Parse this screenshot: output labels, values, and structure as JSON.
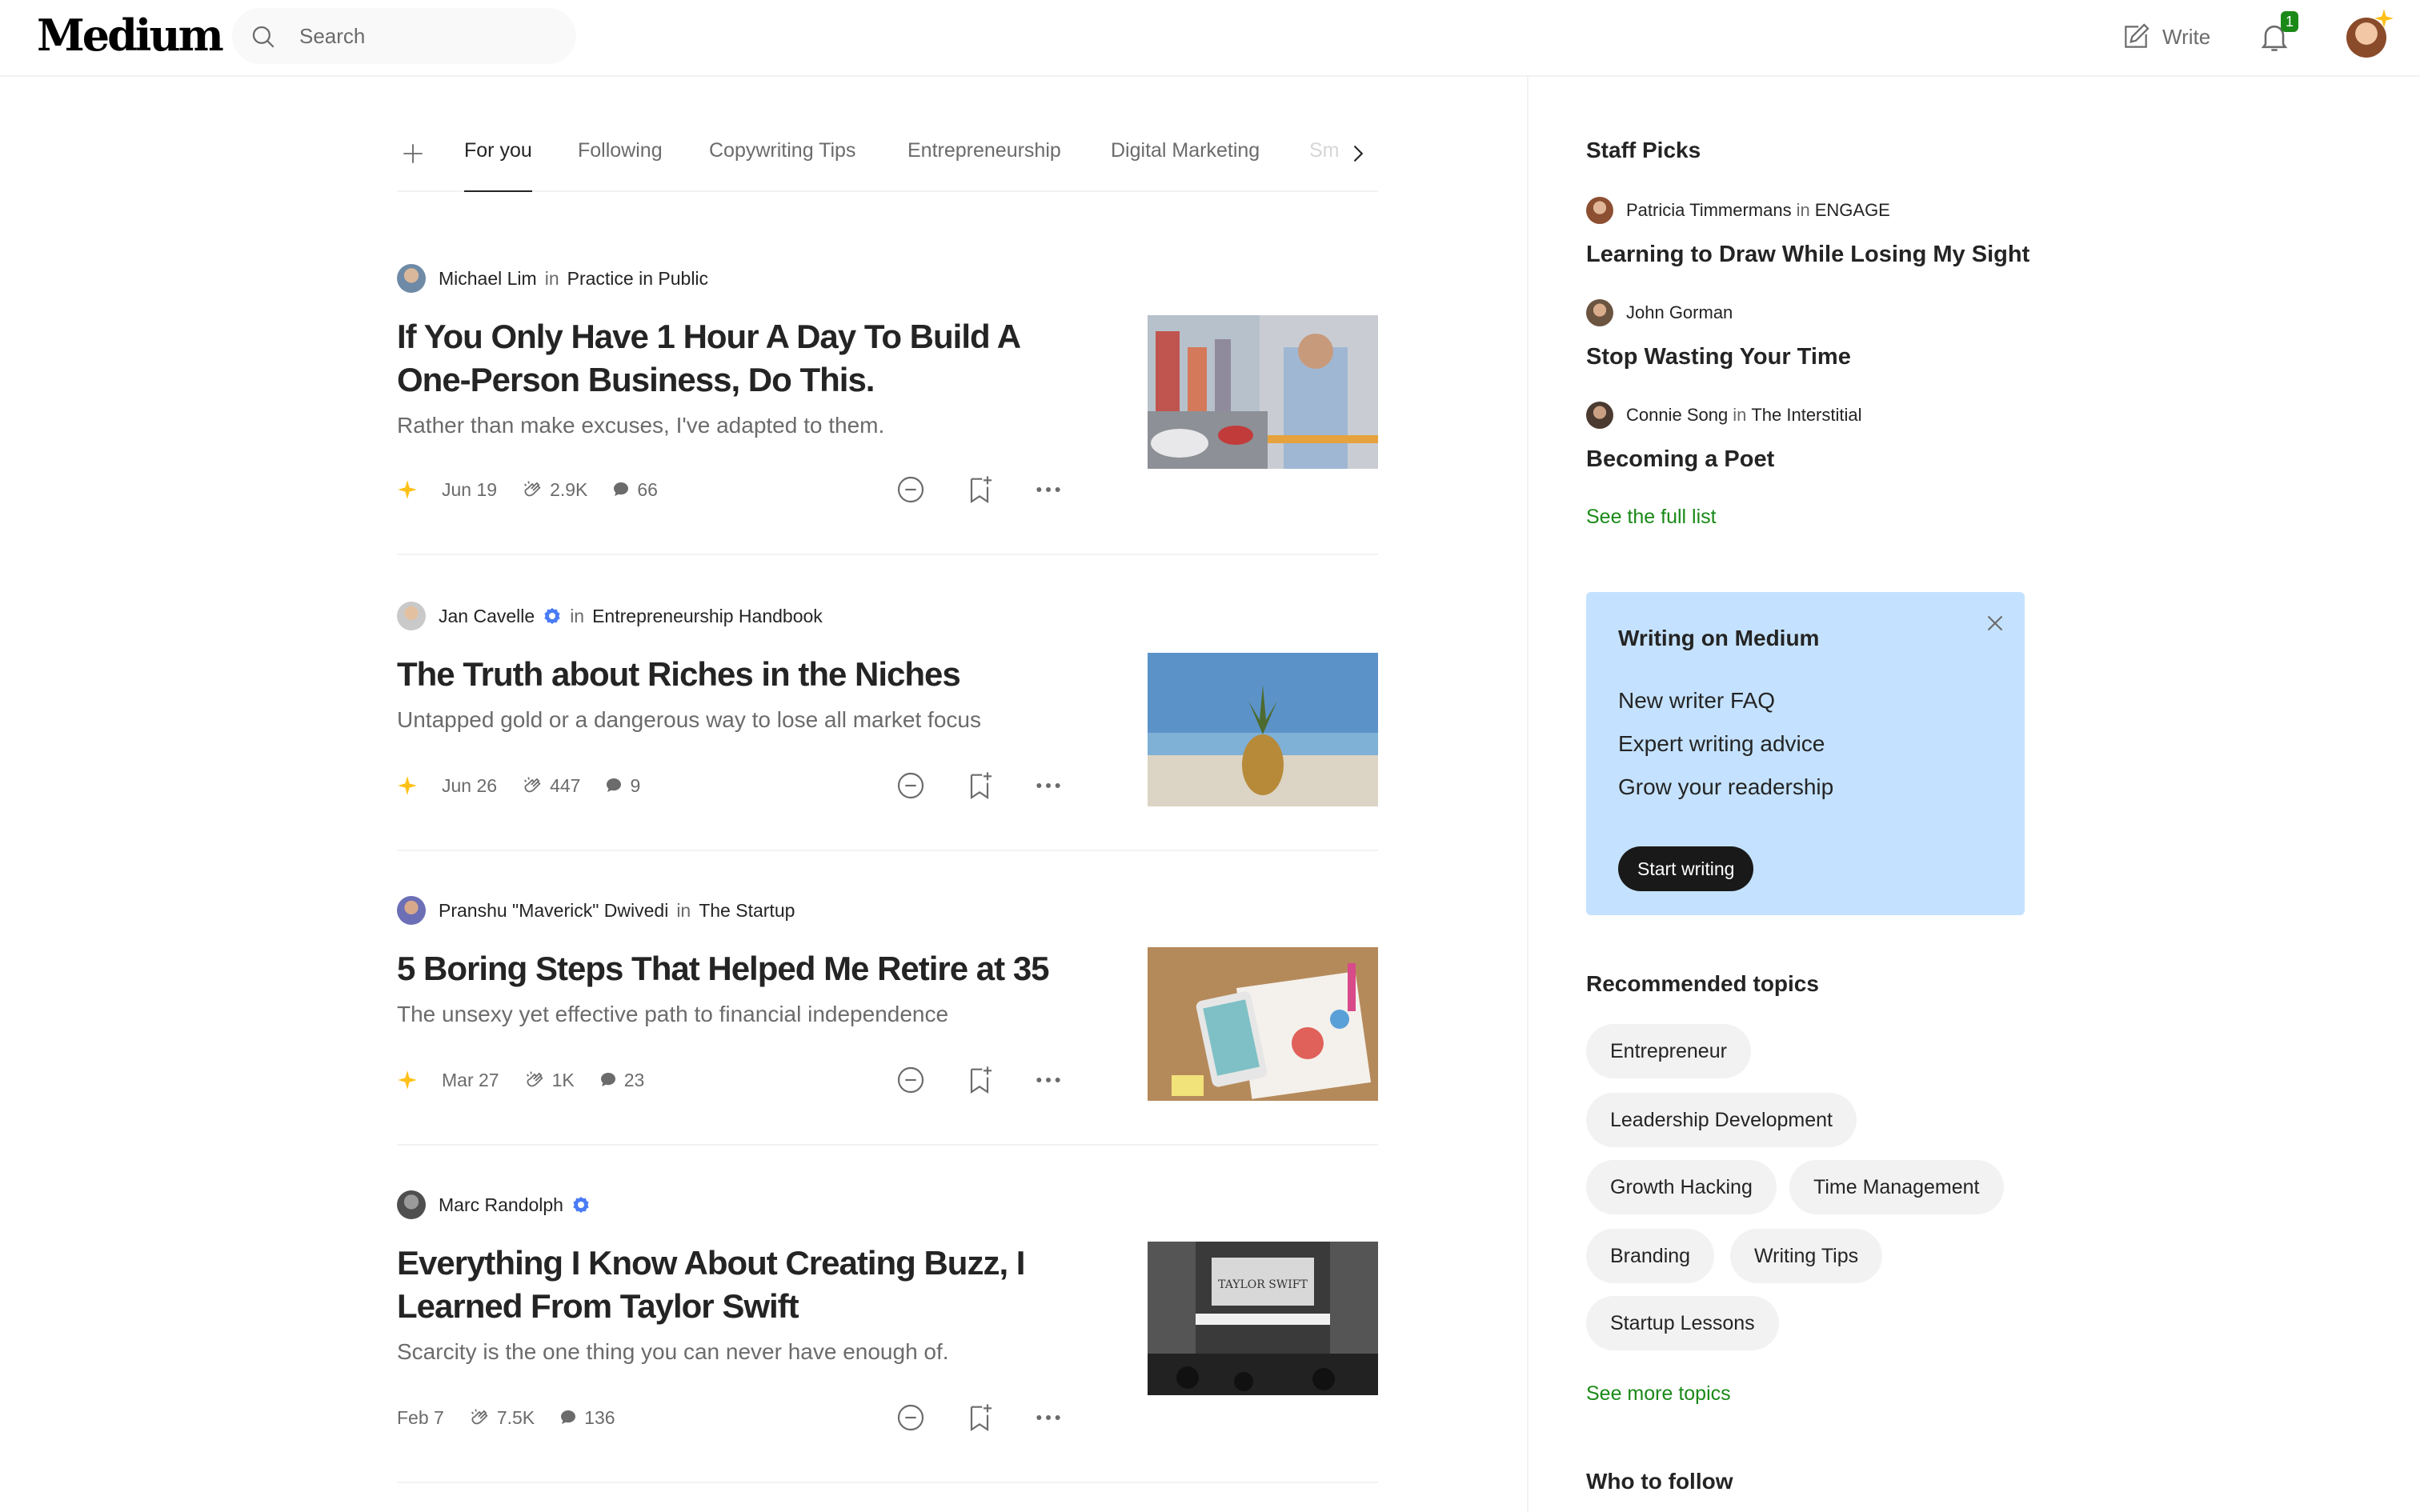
{
  "header": {
    "logo": "Medium",
    "search_placeholder": "Search",
    "write_label": "Write",
    "notification_count": "1"
  },
  "tabs": [
    {
      "label": "For you",
      "active": true
    },
    {
      "label": "Following"
    },
    {
      "label": "Copywriting Tips"
    },
    {
      "label": "Entrepreneurship"
    },
    {
      "label": "Digital Marketing"
    },
    {
      "label": "Sm"
    }
  ],
  "articles": [
    {
      "author": "Michael Lim",
      "in": "in",
      "publication": "Practice in Public",
      "title": "If You Only Have 1 Hour A Day To Build A One-Person Business, Do This.",
      "subtitle": "Rather than make excuses, I've adapted to them.",
      "date": "Jun 19",
      "claps": "2.9K",
      "comments": "66",
      "member_only": true,
      "thumb": "street-portrait"
    },
    {
      "author": "Jan Cavelle",
      "in": "in",
      "publication": "Entrepreneurship Handbook",
      "verified": true,
      "title": "The Truth about Riches in the Niches",
      "subtitle": "Untapped gold or a dangerous way to lose all market focus",
      "date": "Jun 26",
      "claps": "447",
      "comments": "9",
      "member_only": true,
      "thumb": "pineapple-beach"
    },
    {
      "author": "Pranshu \"Maverick\" Dwivedi",
      "in": "in",
      "publication": "The Startup",
      "title": "5 Boring Steps That Helped Me Retire at 35",
      "subtitle": "The unsexy yet effective path to financial independence",
      "date": "Mar 27",
      "claps": "1K",
      "comments": "23",
      "member_only": true,
      "thumb": "desk-charts"
    },
    {
      "author": "Marc Randolph",
      "verified": true,
      "title": "Everything I Know About Creating Buzz, I Learned From Taylor Swift",
      "subtitle": "Scarcity is the one thing you can never have enough of.",
      "date": "Feb 7",
      "claps": "7.5K",
      "comments": "136",
      "member_only": false,
      "thumb": "theater-marquee",
      "thumb_text": "TAYLOR SWIFT"
    }
  ],
  "sidebar": {
    "staff_picks_heading": "Staff Picks",
    "picks": [
      {
        "author": "Patricia Timmermans",
        "in": "in",
        "publication": "ENGAGE",
        "title": "Learning to Draw While Losing My Sight"
      },
      {
        "author": "John Gorman",
        "title": "Stop Wasting Your Time"
      },
      {
        "author": "Connie Song",
        "in": "in",
        "publication": "The Interstitial",
        "title": "Becoming a Poet"
      }
    ],
    "see_full_list": "See the full list",
    "promo": {
      "title": "Writing on Medium",
      "links": [
        "New writer FAQ",
        "Expert writing advice",
        "Grow your readership"
      ],
      "button": "Start writing"
    },
    "recommended_heading": "Recommended topics",
    "topics": [
      "Entrepreneur",
      "Leadership Development",
      "Growth Hacking",
      "Time Management",
      "Branding",
      "Writing Tips",
      "Startup Lessons"
    ],
    "see_more_topics": "See more topics",
    "who_to_follow": "Who to follow"
  },
  "colors": {
    "accent_green": "#1a8917",
    "member_star": "#ffc017",
    "promo_bg": "#c4e2ff",
    "verified_blue": "#4a7cf7"
  }
}
